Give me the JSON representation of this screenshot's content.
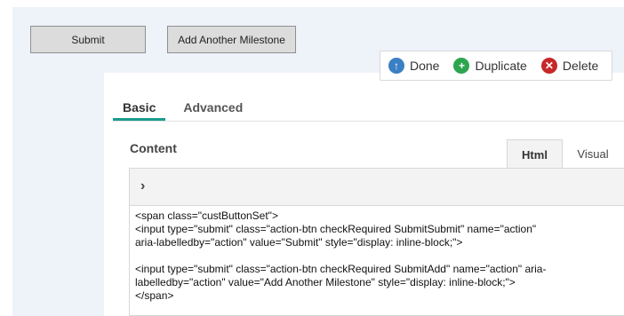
{
  "preview": {
    "submit_label": "Submit",
    "add_label": "Add Another Milestone"
  },
  "toolbar": {
    "done_label": "Done",
    "duplicate_label": "Duplicate",
    "delete_label": "Delete",
    "done_icon": "arrow-up-icon",
    "duplicate_icon": "plus-icon",
    "delete_icon": "x-icon"
  },
  "tabs": {
    "basic": "Basic",
    "advanced": "Advanced"
  },
  "content": {
    "label": "Content",
    "mode_html": "Html",
    "mode_visual": "Visual",
    "toolbar_toggle": "›",
    "code_lines": [
      "<span class=\"custButtonSet\">",
      "<input type=\"submit\" class=\"action-btn checkRequired SubmitSubmit\" name=\"action\"",
      "aria-labelledby=\"action\" value=\"Submit\" style=\"display: inline-block;\">",
      "",
      "<input type=\"submit\" class=\"action-btn checkRequired SubmitAdd\" name=\"action\" aria-",
      "labelledby=\"action\" value=\"Add Another Milestone\" style=\"display: inline-block;\">",
      "</span>"
    ]
  },
  "colors": {
    "tab_accent": "#1a9c8c",
    "done": "#3b7fc4",
    "duplicate": "#2da44e",
    "delete": "#c62828",
    "preview_bg": "#eef3fa"
  }
}
